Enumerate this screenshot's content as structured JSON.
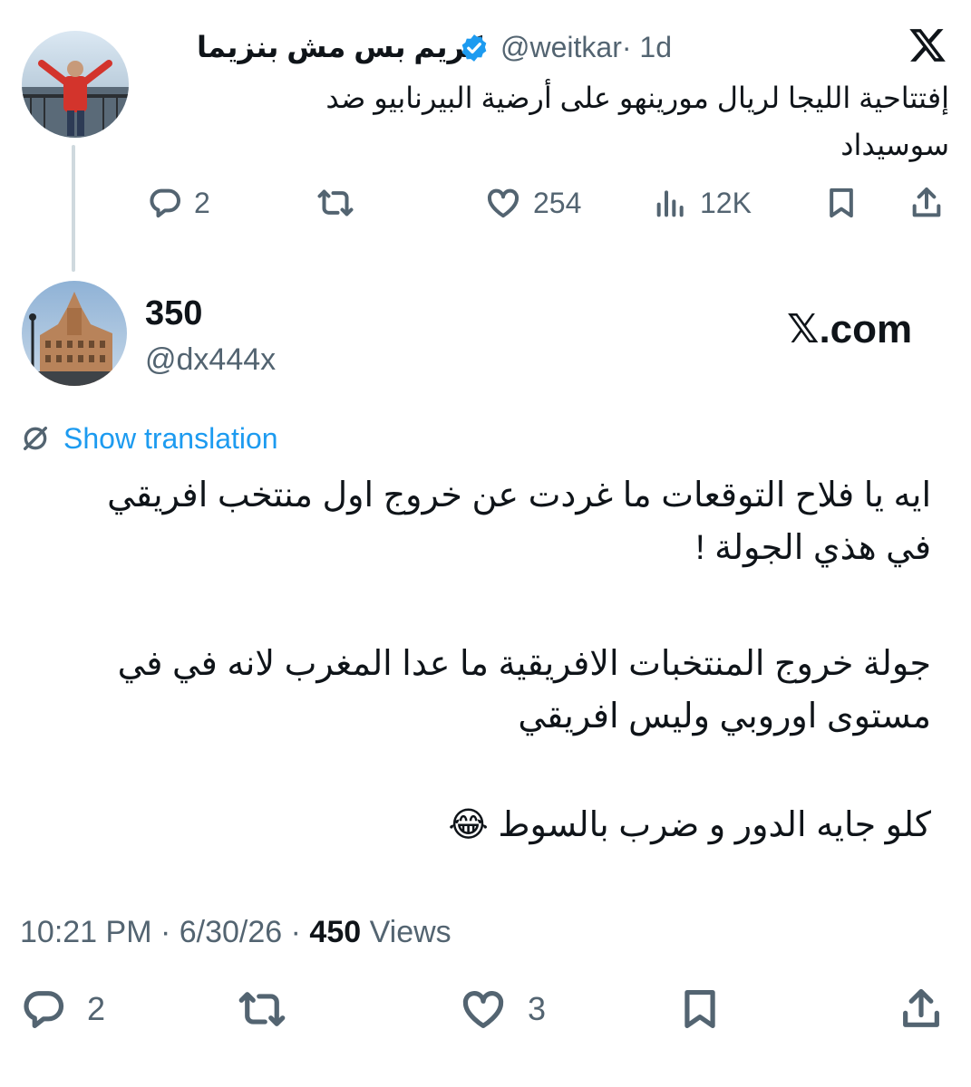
{
  "quoted_tweet": {
    "author_name": "كريم بس مش بنزيما",
    "handle": "@weitkar",
    "time": "· 1d",
    "text_lines": [
      "إفتتاحية الليجا لريال مورينهو على أرضية البيرنابيو ضد",
      "سوسيداد"
    ],
    "replies": "2",
    "likes": "254",
    "views": "12K"
  },
  "tweet": {
    "author_name": "350",
    "handle": "@dx444x",
    "watermark": "𝕏.com",
    "show_translation": "Show translation",
    "paragraphs": [
      [
        "ايه يا فلاح التوقعات ما غردت عن خروج اول منتخب افريقي",
        "في هذي الجولة !"
      ],
      [
        "جولة خروج المنتخبات الافريقية ما عدا المغرب لانه في في",
        "مستوى اوروبي وليس افريقي"
      ],
      [
        "كلو جايه الدور و ضرب بالسوط 😂"
      ]
    ],
    "time": "10:21 PM · 6/30/26 · ",
    "views_count": "450",
    "views_label": " Views",
    "replies": "2",
    "likes": "3"
  },
  "colors": {
    "accent": "#1d9bf0",
    "muted": "#536471",
    "text": "#0f1419",
    "verified": "#1d9bf0"
  },
  "icons": [
    "x-logo-icon",
    "verified-badge-icon",
    "reply-icon",
    "retweet-icon",
    "like-icon",
    "views-icon",
    "bookmark-icon",
    "share-icon",
    "translate-icon"
  ]
}
